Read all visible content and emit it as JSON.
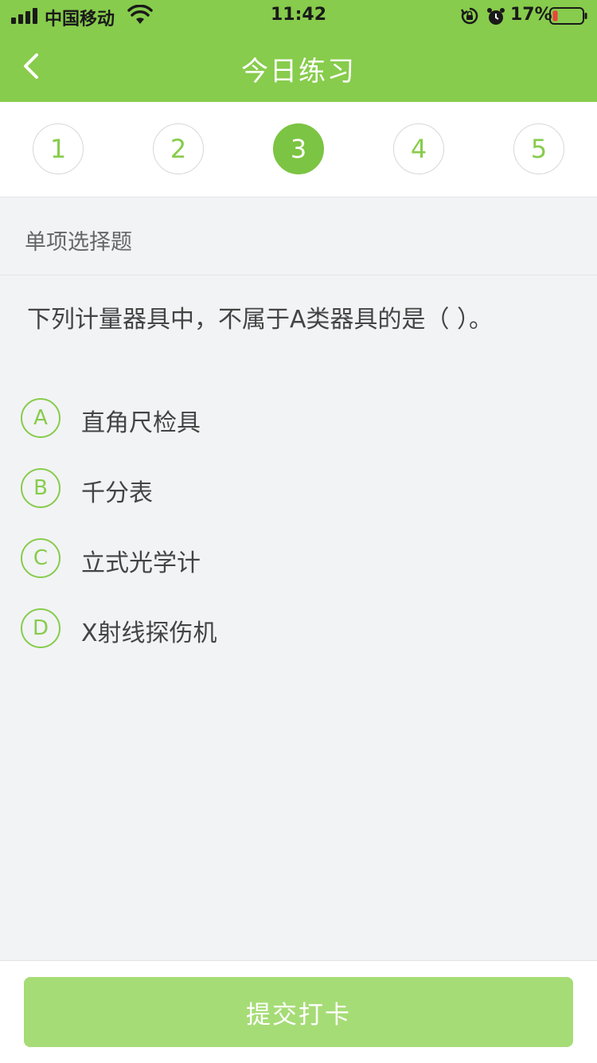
{
  "status_bar": {
    "carrier": "中国移动",
    "time": "11:42",
    "battery_percent": "17%",
    "icons": [
      "signal-icon",
      "wifi-icon",
      "rotation-lock-icon",
      "alarm-icon",
      "battery-icon"
    ]
  },
  "nav": {
    "title": "今日练习",
    "back_icon": "chevron-left-icon"
  },
  "steps": {
    "items": [
      "1",
      "2",
      "3",
      "4",
      "5"
    ],
    "active": "3"
  },
  "question": {
    "type_label": "单项选择题",
    "text": "下列计量器具中，不属于A类器具的是（    ）。",
    "options": [
      {
        "letter": "A",
        "text": "直角尺检具"
      },
      {
        "letter": "B",
        "text": "千分表"
      },
      {
        "letter": "C",
        "text": "立式光学计"
      },
      {
        "letter": "D",
        "text": "X射线探伤机"
      }
    ]
  },
  "footer": {
    "submit_label": "提交打卡"
  },
  "colors": {
    "brand_green": "#87cc4c",
    "active_step": "#7cc443",
    "submit_button": "#a6dc76",
    "background": "#f2f3f5"
  }
}
